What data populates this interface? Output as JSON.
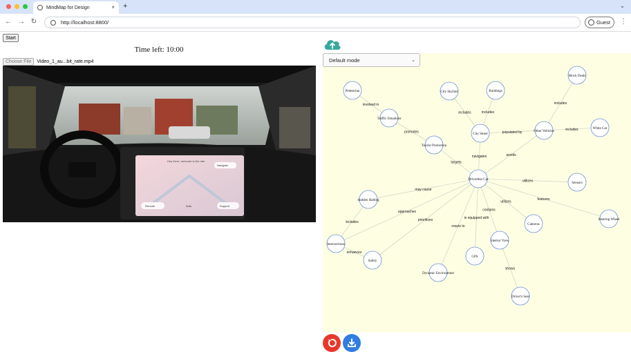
{
  "browser": {
    "tab_title": "MindMap for Design",
    "tab_close": "×",
    "new_tab": "+",
    "tab_menu": "⌄",
    "url": "http://localhost:8800/",
    "profile_label": "Guest",
    "menu": "⋮",
    "nav": {
      "back": "←",
      "forward": "→",
      "reload": "↻"
    }
  },
  "controls": {
    "start_label": "Start",
    "timer_text": "Time left: 10:00",
    "file_button_label": "Choose File",
    "file_name": "Video_1_au...bit_rate.mp4"
  },
  "video_screen": {
    "left_button": "Reroute",
    "mid_text": "Auto",
    "right_button": "Support",
    "top_text": "Hey there, welcome to the ride",
    "top_right": "Navigate"
  },
  "mindmap": {
    "mode_selected": "Default mode",
    "nodes": [
      {
        "id": "pedestrian",
        "label": "Pedestrian"
      },
      {
        "id": "traffic",
        "label": "Traffic Situations"
      },
      {
        "id": "skyline",
        "label": "City Skyline"
      },
      {
        "id": "buildings",
        "label": "Buildings"
      },
      {
        "id": "street",
        "label": "City Street"
      },
      {
        "id": "promo",
        "label": "Tourist Promotion"
      },
      {
        "id": "vehicles",
        "label": "Other Vehicles"
      },
      {
        "id": "block",
        "label": "Block Deals"
      },
      {
        "id": "white",
        "label": "White Car"
      },
      {
        "id": "car",
        "label": "Driverless Car"
      },
      {
        "id": "sensors",
        "label": "Sensors"
      },
      {
        "id": "wheel",
        "label": "Steering Wheel"
      },
      {
        "id": "braking",
        "label": "Sudden Halting"
      },
      {
        "id": "cameras",
        "label": "Cameras"
      },
      {
        "id": "interior",
        "label": "Interior View"
      },
      {
        "id": "gps",
        "label": "GPS"
      },
      {
        "id": "intersections",
        "label": "Intersections"
      },
      {
        "id": "safety",
        "label": "Safety"
      },
      {
        "id": "dynamic",
        "label": "Dynamic Environment"
      },
      {
        "id": "seat",
        "label": "Driver's Seat"
      }
    ],
    "edges": [
      {
        "from": "pedestrian",
        "to": "traffic",
        "label": "involved in"
      },
      {
        "from": "traffic",
        "to": "promo",
        "label": "promotes"
      },
      {
        "from": "skyline",
        "to": "street",
        "label": "includes"
      },
      {
        "from": "buildings",
        "to": "street",
        "label": "includes"
      },
      {
        "from": "street",
        "to": "vehicles",
        "label": "populated by"
      },
      {
        "from": "vehicles",
        "to": "block",
        "label": "includes"
      },
      {
        "from": "vehicles",
        "to": "white",
        "label": "includes"
      },
      {
        "from": "car",
        "to": "street",
        "label": "navigates"
      },
      {
        "from": "car",
        "to": "vehicles",
        "label": "avoids"
      },
      {
        "from": "car",
        "to": "promo",
        "label": "targets"
      },
      {
        "from": "car",
        "to": "sensors",
        "label": "utilizes"
      },
      {
        "from": "car",
        "to": "wheel",
        "label": "features"
      },
      {
        "from": "car",
        "to": "braking",
        "label": "may cause"
      },
      {
        "from": "car",
        "to": "cameras",
        "label": "utilizes"
      },
      {
        "from": "car",
        "to": "interior",
        "label": "contains"
      },
      {
        "from": "car",
        "to": "gps",
        "label": "is equipped with"
      },
      {
        "from": "car",
        "to": "intersections",
        "label": "approaches"
      },
      {
        "from": "car",
        "to": "safety",
        "label": "prioritizes"
      },
      {
        "from": "car",
        "to": "dynamic",
        "label": "reacts to"
      },
      {
        "from": "braking",
        "to": "intersections",
        "label": "includes"
      },
      {
        "from": "intersections",
        "to": "safety",
        "label": "enhances"
      },
      {
        "from": "interior",
        "to": "seat",
        "label": "shows"
      }
    ]
  },
  "colors": {
    "mindmap_bg": "#fefee3",
    "node_stroke": "#6b8fd6",
    "edge_stroke": "#cfd8c8",
    "reset": "#e8382c",
    "download": "#2f7de1",
    "cloud": "#38a89d"
  },
  "icons": {
    "cloud": "cloud-upload-icon",
    "reset": "reset-icon",
    "download": "download-icon"
  }
}
